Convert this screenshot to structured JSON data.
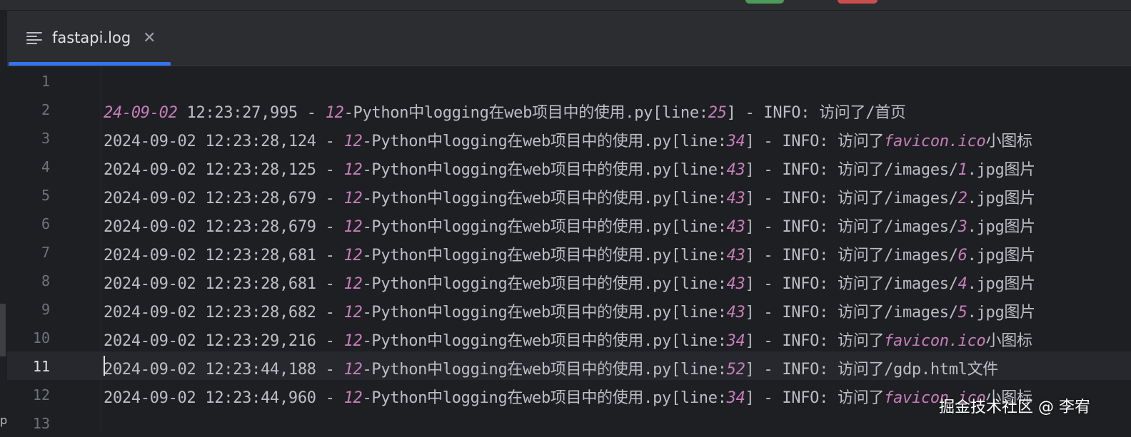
{
  "tab": {
    "label": "fastapi.log",
    "icon": "text-file-icon",
    "close_icon": "close-icon"
  },
  "accent": "#3574f0",
  "watermark": "掘金技术社区 @ 李宥",
  "left_strip_glyph": "p",
  "current_line": 11,
  "lines": [
    {
      "n": "1",
      "parts": []
    },
    {
      "n": "2",
      "parts": [
        {
          "t": "24-09-02",
          "num": true
        },
        {
          "t": " 12:23:27,995 - "
        },
        {
          "t": "12",
          "num": true
        },
        {
          "t": "-Python中logging在web项目中的使用.py[line:"
        },
        {
          "t": "25",
          "num": true
        },
        {
          "t": "] - INFO: 访问了/首页"
        }
      ]
    },
    {
      "n": "3",
      "parts": [
        {
          "t": "2024-09-02 12:23:28,124 - "
        },
        {
          "t": "12",
          "num": true
        },
        {
          "t": "-Python中logging在web项目中的使用.py[line:"
        },
        {
          "t": "34",
          "num": true
        },
        {
          "t": "] - INFO: 访问了"
        },
        {
          "t": "favicon.ico",
          "num": true
        },
        {
          "t": "小图标"
        }
      ]
    },
    {
      "n": "4",
      "parts": [
        {
          "t": "2024-09-02 12:23:28,125 - "
        },
        {
          "t": "12",
          "num": true
        },
        {
          "t": "-Python中logging在web项目中的使用.py[line:"
        },
        {
          "t": "43",
          "num": true
        },
        {
          "t": "] - INFO: 访问了/images/"
        },
        {
          "t": "1",
          "num": true
        },
        {
          "t": ".jpg图片"
        }
      ]
    },
    {
      "n": "5",
      "parts": [
        {
          "t": "2024-09-02 12:23:28,679 - "
        },
        {
          "t": "12",
          "num": true
        },
        {
          "t": "-Python中logging在web项目中的使用.py[line:"
        },
        {
          "t": "43",
          "num": true
        },
        {
          "t": "] - INFO: 访问了/images/"
        },
        {
          "t": "2",
          "num": true
        },
        {
          "t": ".jpg图片"
        }
      ]
    },
    {
      "n": "6",
      "parts": [
        {
          "t": "2024-09-02 12:23:28,679 - "
        },
        {
          "t": "12",
          "num": true
        },
        {
          "t": "-Python中logging在web项目中的使用.py[line:"
        },
        {
          "t": "43",
          "num": true
        },
        {
          "t": "] - INFO: 访问了/images/"
        },
        {
          "t": "3",
          "num": true
        },
        {
          "t": ".jpg图片"
        }
      ]
    },
    {
      "n": "7",
      "parts": [
        {
          "t": "2024-09-02 12:23:28,681 - "
        },
        {
          "t": "12",
          "num": true
        },
        {
          "t": "-Python中logging在web项目中的使用.py[line:"
        },
        {
          "t": "43",
          "num": true
        },
        {
          "t": "] - INFO: 访问了/images/"
        },
        {
          "t": "6",
          "num": true
        },
        {
          "t": ".jpg图片"
        }
      ]
    },
    {
      "n": "8",
      "parts": [
        {
          "t": "2024-09-02 12:23:28,681 - "
        },
        {
          "t": "12",
          "num": true
        },
        {
          "t": "-Python中logging在web项目中的使用.py[line:"
        },
        {
          "t": "43",
          "num": true
        },
        {
          "t": "] - INFO: 访问了/images/"
        },
        {
          "t": "4",
          "num": true
        },
        {
          "t": ".jpg图片"
        }
      ]
    },
    {
      "n": "9",
      "parts": [
        {
          "t": "2024-09-02 12:23:28,682 - "
        },
        {
          "t": "12",
          "num": true
        },
        {
          "t": "-Python中logging在web项目中的使用.py[line:"
        },
        {
          "t": "43",
          "num": true
        },
        {
          "t": "] - INFO: 访问了/images/"
        },
        {
          "t": "5",
          "num": true
        },
        {
          "t": ".jpg图片"
        }
      ]
    },
    {
      "n": "10",
      "parts": [
        {
          "t": "2024-09-02 12:23:29,216 - "
        },
        {
          "t": "12",
          "num": true
        },
        {
          "t": "-Python中logging在web项目中的使用.py[line:"
        },
        {
          "t": "34",
          "num": true
        },
        {
          "t": "] - INFO: 访问了"
        },
        {
          "t": "favicon.ico",
          "num": true
        },
        {
          "t": "小图标"
        }
      ]
    },
    {
      "n": "11",
      "parts": [
        {
          "t": "2024-09-02 12:23:44,188 - "
        },
        {
          "t": "12",
          "num": true
        },
        {
          "t": "-Python中logging在web项目中的使用.py[line:"
        },
        {
          "t": "52",
          "num": true
        },
        {
          "t": "] - INFO: 访问了/gdp.html文件"
        }
      ]
    },
    {
      "n": "12",
      "parts": [
        {
          "t": "2024-09-02 12:23:44,960 - "
        },
        {
          "t": "12",
          "num": true
        },
        {
          "t": "-Python中logging在web项目中的使用.py[line:"
        },
        {
          "t": "34",
          "num": true
        },
        {
          "t": "] - INFO: 访问了"
        },
        {
          "t": "favicon.ico",
          "num": true
        },
        {
          "t": "小图标"
        }
      ]
    },
    {
      "n": "13",
      "parts": []
    }
  ]
}
